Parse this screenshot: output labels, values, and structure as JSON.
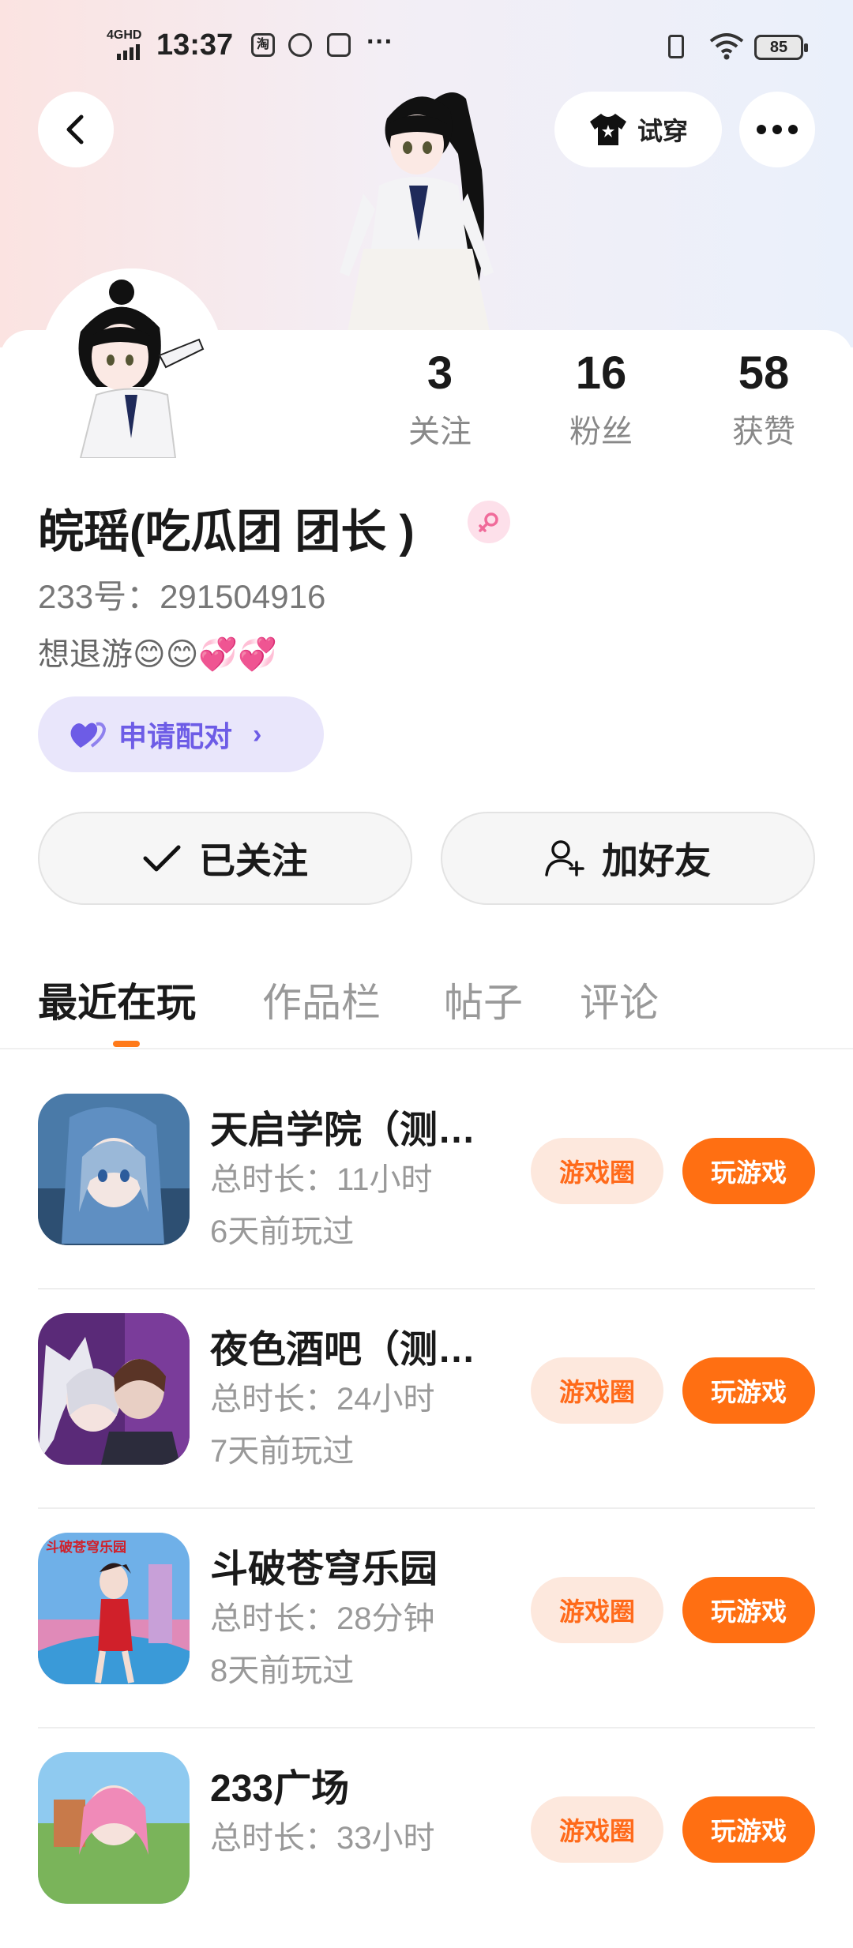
{
  "status_bar": {
    "network": "4GHD",
    "time": "13:37",
    "app_icon_1": "淘",
    "more": "···",
    "battery": "85"
  },
  "header": {
    "tryon_label": "试穿"
  },
  "stats": [
    {
      "value": "3",
      "label": "关注"
    },
    {
      "value": "16",
      "label": "粉丝"
    },
    {
      "value": "58",
      "label": "获赞"
    }
  ],
  "profile": {
    "nickname": "皖瑶(吃瓜团  团长  )",
    "uid": "233号：291504916",
    "bio": "想退游😊😊💞💞"
  },
  "pair_button": {
    "label": "申请配对"
  },
  "actions": {
    "followed_label": "已关注",
    "add_friend_label": "加好友"
  },
  "tabs": [
    {
      "label": "最近在玩",
      "active": true
    },
    {
      "label": "作品栏",
      "active": false
    },
    {
      "label": "帖子",
      "active": false
    },
    {
      "label": "评论",
      "active": false
    }
  ],
  "games": [
    {
      "name": "天启学院（测…",
      "duration": "总时长：11小时",
      "last_played": "6天前玩过",
      "circle_label": "游戏圈",
      "play_label": "玩游戏"
    },
    {
      "name": "夜色酒吧（测…",
      "duration": "总时长：24小时",
      "last_played": "7天前玩过",
      "circle_label": "游戏圈",
      "play_label": "玩游戏"
    },
    {
      "name": "斗破苍穹乐园",
      "duration": "总时长：28分钟",
      "last_played": "8天前玩过",
      "circle_label": "游戏圈",
      "play_label": "玩游戏",
      "icon_text": "斗破苍穹乐园"
    },
    {
      "name": "233广场",
      "duration": "总时长：33小时",
      "last_played": "",
      "circle_label": "游戏圈",
      "play_label": "玩游戏"
    }
  ],
  "colors": {
    "accent_orange": "#ff6f12",
    "pair_purple": "#6d5ce6",
    "female_pink": "#f06b9a"
  }
}
